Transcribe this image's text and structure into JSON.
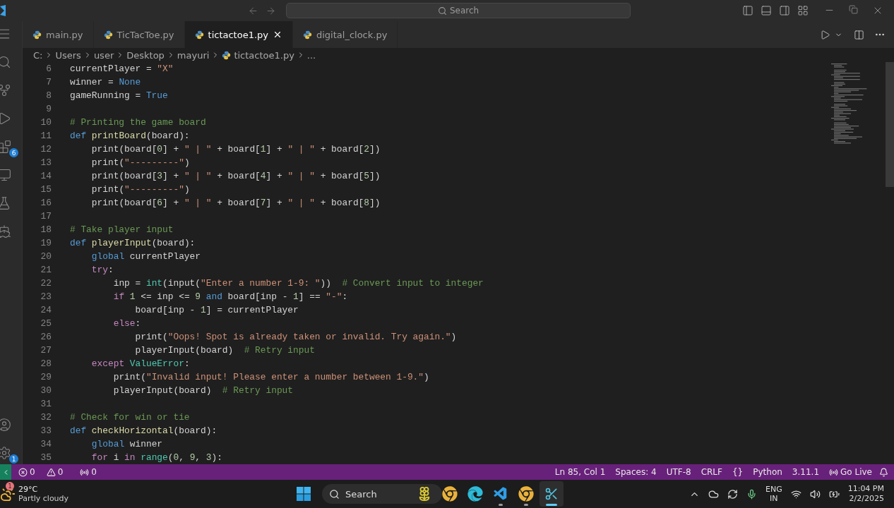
{
  "title_bar": {
    "search_placeholder": "Search"
  },
  "activity_bar": {
    "top": [
      {
        "kind": "menu"
      },
      {
        "kind": "search"
      },
      {
        "kind": "source-control"
      },
      {
        "kind": "run"
      },
      {
        "kind": "extensions",
        "badge": "6"
      },
      {
        "kind": "remote"
      },
      {
        "kind": "testing"
      },
      {
        "kind": "docker"
      }
    ],
    "bottom": [
      {
        "kind": "account"
      },
      {
        "kind": "settings",
        "badge": "1"
      }
    ]
  },
  "tabs": [
    {
      "label": "main.py",
      "selected": false
    },
    {
      "label": "TicTacToe.py",
      "selected": false
    },
    {
      "label": "tictactoe1.py",
      "selected": true
    },
    {
      "label": "digital_clock.py",
      "selected": false
    }
  ],
  "breadcrumb": [
    {
      "kind": "folder",
      "text": "C:"
    },
    {
      "kind": "folder",
      "text": "Users"
    },
    {
      "kind": "folder",
      "text": "user"
    },
    {
      "kind": "folder",
      "text": "Desktop"
    },
    {
      "kind": "folder",
      "text": "mayuri"
    },
    {
      "kind": "file",
      "text": "tictactoe1.py"
    },
    {
      "kind": "more",
      "text": "..."
    }
  ],
  "code": [
    {
      "number": "6",
      "tokens": [
        {
          "kind": "plain",
          "text": "currentPlayer = "
        },
        {
          "kind": "string",
          "text": "\"X\""
        }
      ]
    },
    {
      "number": "7",
      "tokens": [
        {
          "kind": "plain",
          "text": "winner = "
        },
        {
          "kind": "constant",
          "text": "None"
        }
      ]
    },
    {
      "number": "8",
      "tokens": [
        {
          "kind": "plain",
          "text": "gameRunning = "
        },
        {
          "kind": "constant",
          "text": "True"
        }
      ]
    },
    {
      "number": "9"
    },
    {
      "number": "10",
      "tokens": [
        {
          "kind": "comment",
          "text": "# Printing the game board"
        }
      ]
    },
    {
      "number": "11",
      "tokens": [
        {
          "kind": "keyword",
          "text": "def "
        },
        {
          "kind": "function",
          "text": "printBoard"
        },
        {
          "kind": "plain",
          "text": "(board):"
        }
      ]
    },
    {
      "number": "12",
      "tokens": [
        {
          "kind": "plain",
          "text": "    print(board["
        },
        {
          "kind": "number",
          "text": "0"
        },
        {
          "kind": "plain",
          "text": "] + "
        },
        {
          "kind": "string",
          "text": "\" | \""
        },
        {
          "kind": "plain",
          "text": " + board["
        },
        {
          "kind": "number",
          "text": "1"
        },
        {
          "kind": "plain",
          "text": "] + "
        },
        {
          "kind": "string",
          "text": "\" | \""
        },
        {
          "kind": "plain",
          "text": " + board["
        },
        {
          "kind": "number",
          "text": "2"
        },
        {
          "kind": "plain",
          "text": "])"
        }
      ]
    },
    {
      "number": "13",
      "tokens": [
        {
          "kind": "plain",
          "text": "    print("
        },
        {
          "kind": "string",
          "text": "\"---------\""
        },
        {
          "kind": "plain",
          "text": ")"
        }
      ]
    },
    {
      "number": "14",
      "tokens": [
        {
          "kind": "plain",
          "text": "    print(board["
        },
        {
          "kind": "number",
          "text": "3"
        },
        {
          "kind": "plain",
          "text": "] + "
        },
        {
          "kind": "string",
          "text": "\" | \""
        },
        {
          "kind": "plain",
          "text": " + board["
        },
        {
          "kind": "number",
          "text": "4"
        },
        {
          "kind": "plain",
          "text": "] + "
        },
        {
          "kind": "string",
          "text": "\" | \""
        },
        {
          "kind": "plain",
          "text": " + board["
        },
        {
          "kind": "number",
          "text": "5"
        },
        {
          "kind": "plain",
          "text": "])"
        }
      ]
    },
    {
      "number": "15",
      "tokens": [
        {
          "kind": "plain",
          "text": "    print("
        },
        {
          "kind": "string",
          "text": "\"---------\""
        },
        {
          "kind": "plain",
          "text": ")"
        }
      ]
    },
    {
      "number": "16",
      "tokens": [
        {
          "kind": "plain",
          "text": "    print(board["
        },
        {
          "kind": "number",
          "text": "6"
        },
        {
          "kind": "plain",
          "text": "] + "
        },
        {
          "kind": "string",
          "text": "\" | \""
        },
        {
          "kind": "plain",
          "text": " + board["
        },
        {
          "kind": "number",
          "text": "7"
        },
        {
          "kind": "plain",
          "text": "] + "
        },
        {
          "kind": "string",
          "text": "\" | \""
        },
        {
          "kind": "plain",
          "text": " + board["
        },
        {
          "kind": "number",
          "text": "8"
        },
        {
          "kind": "plain",
          "text": "])"
        }
      ]
    },
    {
      "number": "17"
    },
    {
      "number": "18",
      "tokens": [
        {
          "kind": "comment",
          "text": "# Take player input"
        }
      ]
    },
    {
      "number": "19",
      "tokens": [
        {
          "kind": "keyword",
          "text": "def "
        },
        {
          "kind": "function",
          "text": "playerInput"
        },
        {
          "kind": "plain",
          "text": "(board):"
        }
      ]
    },
    {
      "number": "20",
      "tokens": [
        {
          "kind": "keyword",
          "text": "    global "
        },
        {
          "kind": "plain",
          "text": "currentPlayer"
        }
      ]
    },
    {
      "number": "21",
      "tokens": [
        {
          "kind": "control",
          "text": "    try"
        },
        {
          "kind": "plain",
          "text": ":"
        }
      ]
    },
    {
      "number": "22",
      "tokens": [
        {
          "kind": "plain",
          "text": "        inp = "
        },
        {
          "kind": "class",
          "text": "int"
        },
        {
          "kind": "plain",
          "text": "(input("
        },
        {
          "kind": "string",
          "text": "\"Enter a number 1-9: \""
        },
        {
          "kind": "plain",
          "text": "))  "
        },
        {
          "kind": "comment",
          "text": "# Convert input to integer"
        }
      ]
    },
    {
      "number": "23",
      "tokens": [
        {
          "kind": "control",
          "text": "        if "
        },
        {
          "kind": "number",
          "text": "1"
        },
        {
          "kind": "plain",
          "text": " <= inp <= "
        },
        {
          "kind": "number",
          "text": "9"
        },
        {
          "kind": "keyword",
          "text": " and "
        },
        {
          "kind": "plain",
          "text": "board[inp - "
        },
        {
          "kind": "number",
          "text": "1"
        },
        {
          "kind": "plain",
          "text": "] == "
        },
        {
          "kind": "string",
          "text": "\"-\""
        },
        {
          "kind": "plain",
          "text": ":"
        }
      ]
    },
    {
      "number": "24",
      "tokens": [
        {
          "kind": "plain",
          "text": "            board[inp - "
        },
        {
          "kind": "number",
          "text": "1"
        },
        {
          "kind": "plain",
          "text": "] = currentPlayer"
        }
      ]
    },
    {
      "number": "25",
      "tokens": [
        {
          "kind": "control",
          "text": "        else"
        },
        {
          "kind": "plain",
          "text": ":"
        }
      ]
    },
    {
      "number": "26",
      "tokens": [
        {
          "kind": "plain",
          "text": "            print("
        },
        {
          "kind": "string",
          "text": "\"Oops! Spot is already taken or invalid. Try again.\""
        },
        {
          "kind": "plain",
          "text": ")"
        }
      ]
    },
    {
      "number": "27",
      "tokens": [
        {
          "kind": "plain",
          "text": "            playerInput(board)  "
        },
        {
          "kind": "comment",
          "text": "# Retry input"
        }
      ]
    },
    {
      "number": "28",
      "tokens": [
        {
          "kind": "control",
          "text": "    except "
        },
        {
          "kind": "class",
          "text": "ValueError"
        },
        {
          "kind": "plain",
          "text": ":"
        }
      ]
    },
    {
      "number": "29",
      "tokens": [
        {
          "kind": "plain",
          "text": "        print("
        },
        {
          "kind": "string",
          "text": "\"Invalid input! Please enter a number between 1-9.\""
        },
        {
          "kind": "plain",
          "text": ")"
        }
      ]
    },
    {
      "number": "30",
      "tokens": [
        {
          "kind": "plain",
          "text": "        playerInput(board)  "
        },
        {
          "kind": "comment",
          "text": "# Retry input"
        }
      ]
    },
    {
      "number": "31"
    },
    {
      "number": "32",
      "tokens": [
        {
          "kind": "comment",
          "text": "# Check for win or tie"
        }
      ]
    },
    {
      "number": "33",
      "tokens": [
        {
          "kind": "keyword",
          "text": "def "
        },
        {
          "kind": "function",
          "text": "checkHorizontal"
        },
        {
          "kind": "plain",
          "text": "(board):"
        }
      ]
    },
    {
      "number": "34",
      "tokens": [
        {
          "kind": "keyword",
          "text": "    global "
        },
        {
          "kind": "plain",
          "text": "winner"
        }
      ]
    },
    {
      "number": "35",
      "tokens": [
        {
          "kind": "control",
          "text": "    for "
        },
        {
          "kind": "plain",
          "text": "i "
        },
        {
          "kind": "control",
          "text": "in "
        },
        {
          "kind": "class",
          "text": "range"
        },
        {
          "kind": "plain",
          "text": "("
        },
        {
          "kind": "number",
          "text": "0"
        },
        {
          "kind": "plain",
          "text": ", "
        },
        {
          "kind": "number",
          "text": "9"
        },
        {
          "kind": "plain",
          "text": ", "
        },
        {
          "kind": "number",
          "text": "3"
        },
        {
          "kind": "plain",
          "text": "):"
        }
      ]
    }
  ],
  "status_bar": {
    "left": [
      {
        "kind": "errors",
        "text": "0"
      },
      {
        "kind": "warnings",
        "text": "0"
      },
      {
        "kind": "ports",
        "text": "0"
      }
    ],
    "right": [
      {
        "kind": "text",
        "text": "Ln 85, Col 1"
      },
      {
        "kind": "text",
        "text": "Spaces: 4"
      },
      {
        "kind": "text",
        "text": "UTF-8"
      },
      {
        "kind": "text",
        "text": "CRLF"
      },
      {
        "kind": "text",
        "text": "{}"
      },
      {
        "kind": "text",
        "text": "Python"
      },
      {
        "kind": "text",
        "text": "3.11.1"
      },
      {
        "kind": "live",
        "text": "Go Live"
      },
      {
        "kind": "bell"
      }
    ]
  },
  "taskbar": {
    "weather": {
      "badge": "1",
      "temperature": "29°C",
      "condition": "Partly cloudy"
    },
    "search_placeholder": "Search",
    "apps": [
      {
        "kind": "chrome",
        "running": false,
        "selected": false
      },
      {
        "kind": "edge",
        "running": false,
        "selected": false
      },
      {
        "kind": "vscode",
        "running": true,
        "selected": false
      },
      {
        "kind": "chrome",
        "running": true,
        "selected": false
      },
      {
        "kind": "snipping",
        "running": true,
        "selected": true
      }
    ],
    "language": [
      "ENG",
      "IN"
    ],
    "time": "11:04 PM",
    "date": "2/2/2025"
  }
}
